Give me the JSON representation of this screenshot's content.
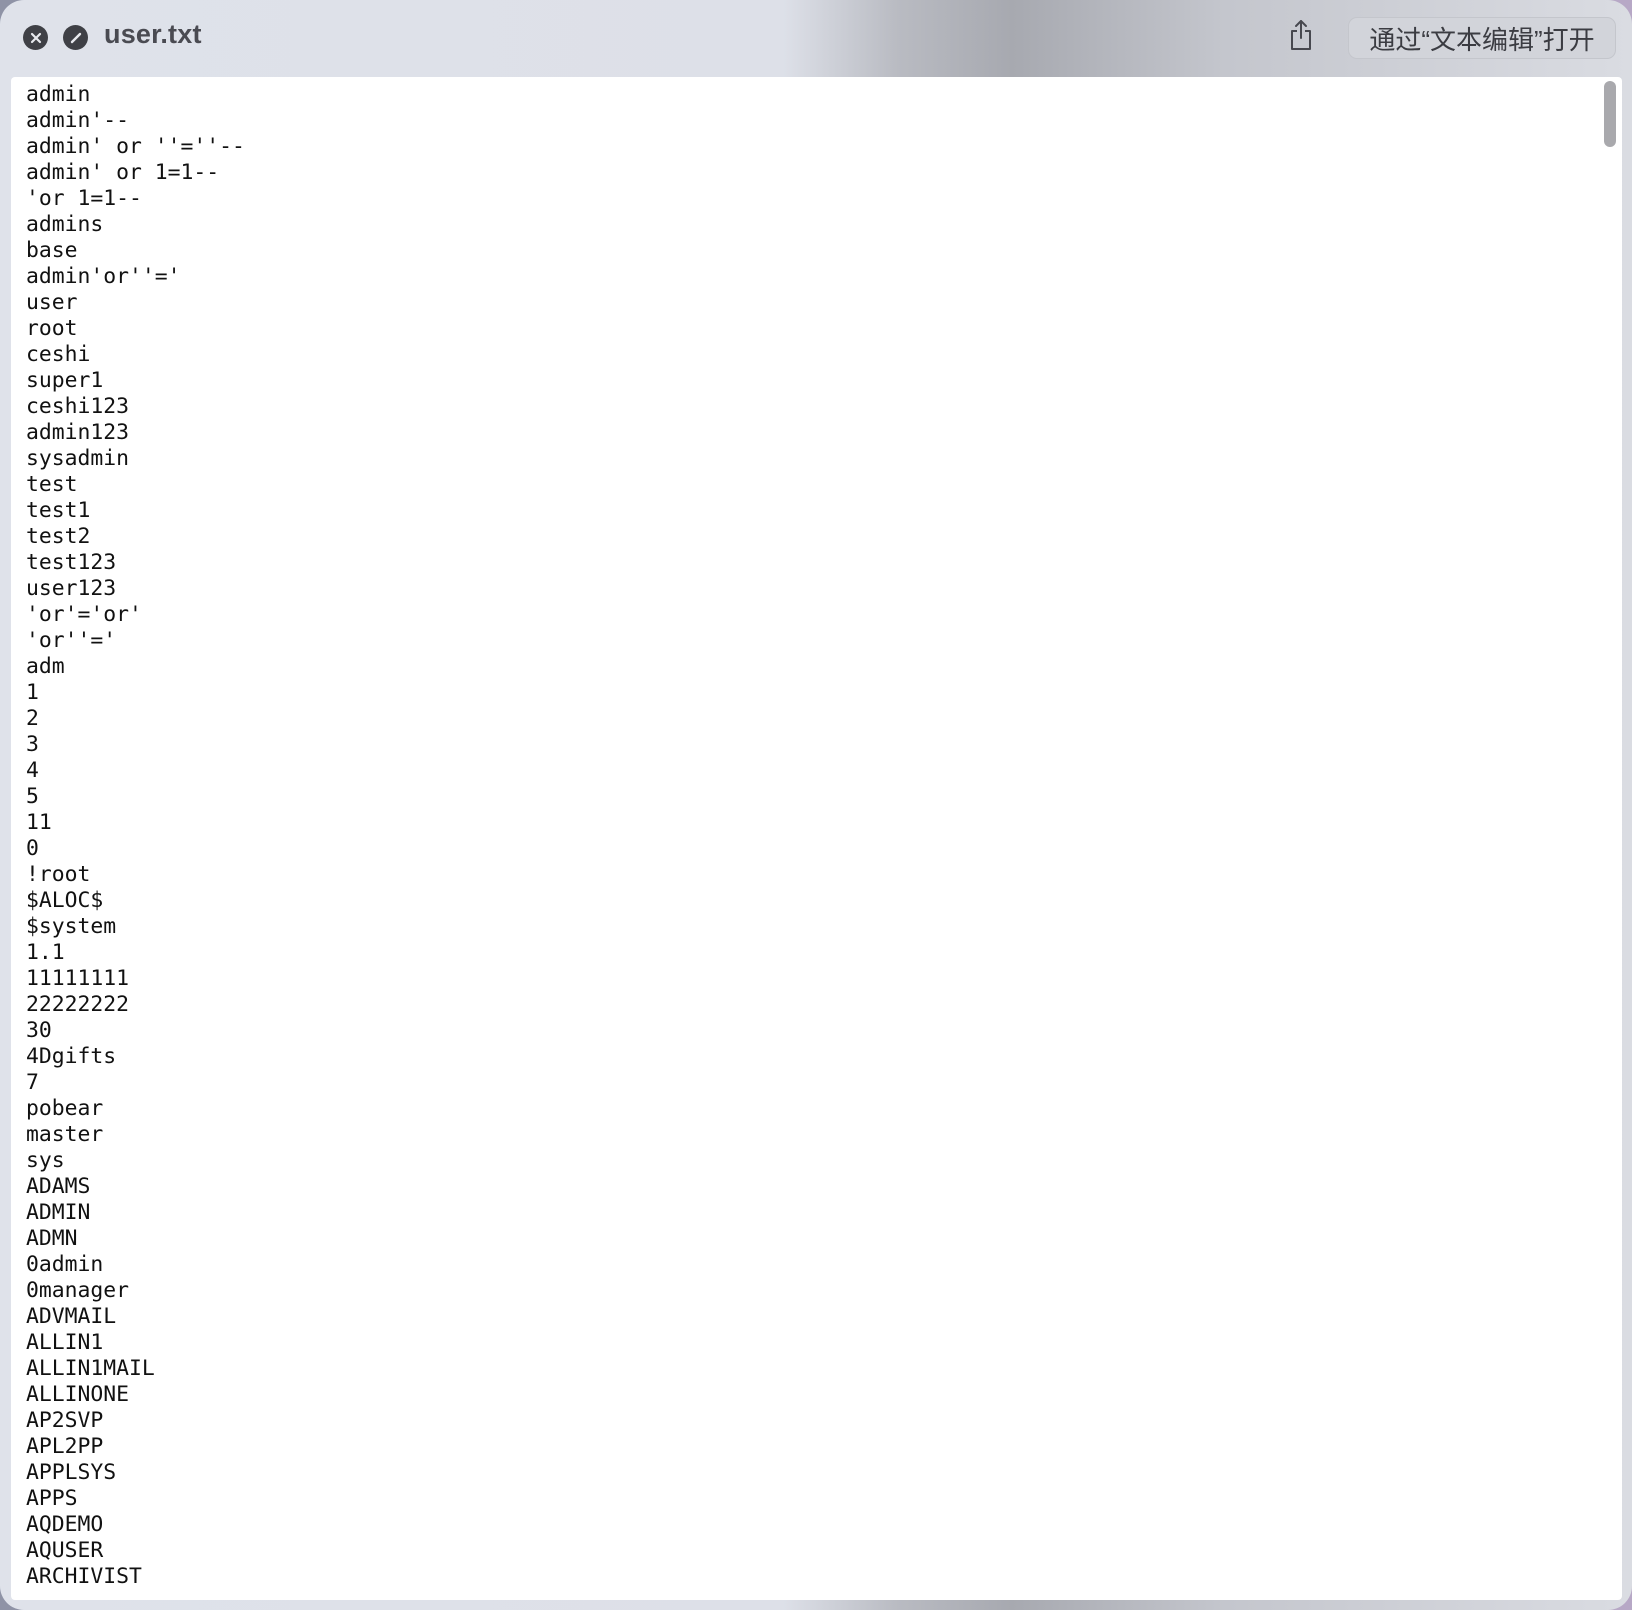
{
  "window": {
    "title": "user.txt",
    "open_with_label": "通过“文本编辑”打开"
  },
  "icons": {
    "close": "close-icon",
    "block": "block-icon",
    "share": "share-icon"
  },
  "colors": {
    "titlebar": "#dfe2ea",
    "button_dark": "#3f4046",
    "content_bg": "#ffffff",
    "text": "#111111"
  },
  "file_content": {
    "lines": [
      "admin",
      "admin'--",
      "admin' or ''=''--",
      "admin' or 1=1--",
      "'or 1=1--",
      "admins",
      "base",
      "admin'or''='",
      "user",
      "root",
      "ceshi",
      "super1",
      "ceshi123",
      "admin123",
      "sysadmin",
      "test",
      "test1",
      "test2",
      "test123",
      "user123",
      "'or'='or'",
      "'or''='",
      "adm",
      "1",
      "2",
      "3",
      "4",
      "5",
      "11",
      "0",
      "!root",
      "$ALOC$",
      "$system",
      "1.1",
      "11111111",
      "22222222",
      "30",
      "4Dgifts",
      "7",
      "pobear",
      "master",
      "sys",
      "ADAMS",
      "ADMIN",
      "ADMN",
      "0admin",
      "0manager",
      "ADVMAIL",
      "ALLIN1",
      "ALLIN1MAIL",
      "ALLINONE",
      "AP2SVP",
      "APL2PP",
      "APPLSYS",
      "APPS",
      "AQDEMO",
      "AQUSER",
      "ARCHIVIST"
    ]
  }
}
